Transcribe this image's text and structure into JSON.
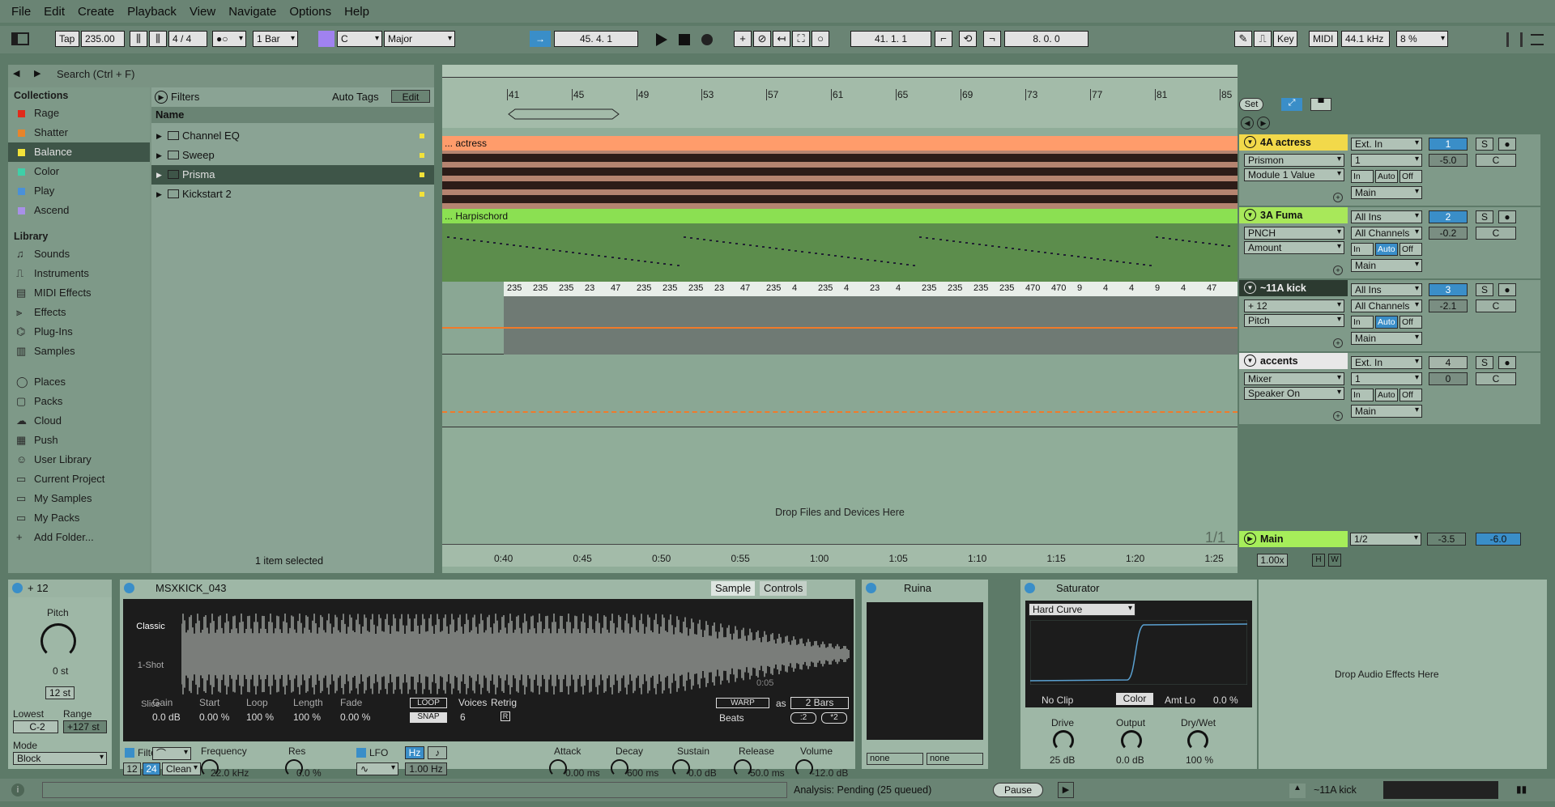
{
  "menu": [
    "File",
    "Edit",
    "Create",
    "Playback",
    "View",
    "Navigate",
    "Options",
    "Help"
  ],
  "transport": {
    "tap": "Tap",
    "bpm": "235.00",
    "sig": "4 / 4",
    "quant": "1 Bar",
    "key": "C",
    "scale": "Major",
    "position": "45.  4.  1",
    "loop_start": "41.  1.  1",
    "loop_length": "8.  0.  0",
    "key_btn": "Key",
    "midi_btn": "MIDI",
    "sample_rate": "44.1 kHz",
    "cpu": "8 %"
  },
  "browser": {
    "search_placeholder": "Search (Ctrl + F)",
    "collections_title": "Collections",
    "collections": [
      {
        "label": "Rage",
        "color": "#e02a1a"
      },
      {
        "label": "Shatter",
        "color": "#e8842a"
      },
      {
        "label": "Balance",
        "color": "#f2e23a"
      },
      {
        "label": "Color",
        "color": "#3fcfa8"
      },
      {
        "label": "Play",
        "color": "#4a90d8"
      },
      {
        "label": "Ascend",
        "color": "#a890e8"
      }
    ],
    "library_title": "Library",
    "library": [
      {
        "label": "Sounds",
        "icon": "♫"
      },
      {
        "label": "Instruments",
        "icon": "⎍"
      },
      {
        "label": "MIDI Effects",
        "icon": "▤"
      },
      {
        "label": "Effects",
        "icon": "⫸"
      },
      {
        "label": "Plug-Ins",
        "icon": "⌬"
      },
      {
        "label": "Samples",
        "icon": "▥"
      }
    ],
    "places": [
      {
        "label": "Places",
        "icon": "◯"
      },
      {
        "label": "Packs",
        "icon": "▢"
      },
      {
        "label": "Cloud",
        "icon": "☁"
      },
      {
        "label": "Push",
        "icon": "▦"
      },
      {
        "label": "User Library",
        "icon": "☺"
      },
      {
        "label": "Current Project",
        "icon": "▭"
      },
      {
        "label": "My Samples",
        "icon": "▭"
      },
      {
        "label": "My Packs",
        "icon": "▭"
      },
      {
        "label": "Add Folder...",
        "icon": "+"
      }
    ],
    "filters": "Filters",
    "auto_tags": "Auto Tags",
    "edit": "Edit",
    "name_col": "Name",
    "files": [
      {
        "label": "Channel EQ",
        "sel": false
      },
      {
        "label": "Sweep",
        "sel": false
      },
      {
        "label": "Prisma",
        "sel": true
      },
      {
        "label": "Kickstart 2",
        "sel": false
      }
    ],
    "status": "1 item selected"
  },
  "ruler": [
    "41",
    "45",
    "49",
    "53",
    "57",
    "61",
    "65",
    "69",
    "73",
    "77",
    "81",
    "85"
  ],
  "time_ruler": [
    "0:40",
    "0:45",
    "0:50",
    "0:55",
    "1:00",
    "1:05",
    "1:10",
    "1:15",
    "1:20",
    "1:25"
  ],
  "set_btn": "Set",
  "tracks": [
    {
      "clip": "... actress",
      "name": "4A actress",
      "input": "Ext. In",
      "in2": "1",
      "dev1": "Prismon",
      "dev2": "Module 1 Value",
      "num": "1",
      "vol": "-5.0",
      "pan": "C",
      "color": "#ff9c6b",
      "hdr": "#f2d94a"
    },
    {
      "clip": "... Harpischord",
      "name": "3A Fuma",
      "input": "All Ins",
      "in2": "All Channels",
      "dev1": "PNCH",
      "dev2": "Amount",
      "num": "2",
      "vol": "-0.2",
      "pan": "C",
      "color": "#8be052",
      "hdr": "#a8e85a"
    },
    {
      "clip": "",
      "name": "~11A kick",
      "input": "All Ins",
      "in2": "All Channels",
      "dev1": "+ 12",
      "dev2": "Pitch",
      "num": "3",
      "vol": "-2.1",
      "pan": "C",
      "color": "#f07a2a",
      "hdr": "#2c3a30"
    },
    {
      "clip": "",
      "name": "accents",
      "input": "Ext. In",
      "in2": "1",
      "dev1": "Mixer",
      "dev2": "Speaker On",
      "num": "4",
      "vol": "0",
      "pan": "C",
      "color": "#f07a2a",
      "hdr": "#e8e8e8"
    }
  ],
  "kick_labels": [
    "235",
    "235",
    "235",
    "23",
    "47",
    "235",
    "235",
    "235",
    "23",
    "47",
    "235",
    "4",
    "235",
    "4",
    "23",
    "4",
    "235",
    "235",
    "235",
    "235",
    "470",
    "470",
    "9",
    "4",
    "4",
    "9",
    "4",
    "47"
  ],
  "routing": {
    "in": "In",
    "auto": "Auto",
    "off": "Off",
    "main": "Main"
  },
  "drop_text": "Drop Files and Devices Here",
  "main_track": {
    "name": "Main",
    "out": "1/2",
    "vol": "-3.5",
    "vol2": "-6.0"
  },
  "zoom": "1.00x",
  "page": "1/1",
  "devices": {
    "pitch": {
      "title": "+ 12",
      "knob": "Pitch",
      "value": "0 st",
      "range_val": "12 st",
      "lowest": "Lowest",
      "range": "Range",
      "low_val": "C-2",
      "hi_val": "+127 st",
      "mode": "Mode",
      "mode_val": "Block"
    },
    "simpler": {
      "title": "MSXKICK_043",
      "tab_sample": "Sample",
      "tab_controls": "Controls",
      "modes": [
        "Classic",
        "1-Shot",
        "Slice"
      ],
      "params": [
        {
          "l": "Gain",
          "v": "0.0 dB"
        },
        {
          "l": "Start",
          "v": "0.00 %"
        },
        {
          "l": "Loop",
          "v": "100 %"
        },
        {
          "l": "Length",
          "v": "100 %"
        },
        {
          "l": "Fade",
          "v": "0.00 %"
        }
      ],
      "loop": "LOOP",
      "snap": "SNAP",
      "voices": "Voices",
      "voices_val": "6",
      "retrig": "Retrig",
      "warp": "WARP",
      "as": "as",
      "bars": "2 Bars",
      "beats": "Beats",
      "half": ":2",
      "double": "*2",
      "time": "0:05",
      "filter": "Filter",
      "freq": "Frequency",
      "freq_val": "22.0 kHz",
      "res": "Res",
      "res_val": "0.0 %",
      "clean": "Clean",
      "f12": "12",
      "f24": "24",
      "lfo": "LFO",
      "hz": "Hz",
      "lfo_rate": "1.00 Hz",
      "env": [
        {
          "l": "Attack",
          "v": "0.00 ms"
        },
        {
          "l": "Decay",
          "v": "600 ms"
        },
        {
          "l": "Sustain",
          "v": "0.0 dB"
        },
        {
          "l": "Release",
          "v": "50.0 ms"
        },
        {
          "l": "Volume",
          "v": "-12.0 dB"
        }
      ]
    },
    "ruina": {
      "title": "Ruina",
      "sel1": "none",
      "sel2": "none"
    },
    "saturator": {
      "title": "Saturator",
      "curve": "Hard Curve",
      "noclip": "No Clip",
      "color": "Color",
      "amtlo": "Amt Lo",
      "amtlo_val": "0.0 %",
      "drive": "Drive",
      "drive_val": "25 dB",
      "output": "Output",
      "output_val": "0.0 dB",
      "drywet": "Dry/Wet",
      "drywet_val": "100 %"
    },
    "drop": "Drop Audio Effects Here"
  },
  "status": {
    "analysis": "Analysis: Pending (25 queued)",
    "pause": "Pause",
    "track": "~11A kick"
  }
}
